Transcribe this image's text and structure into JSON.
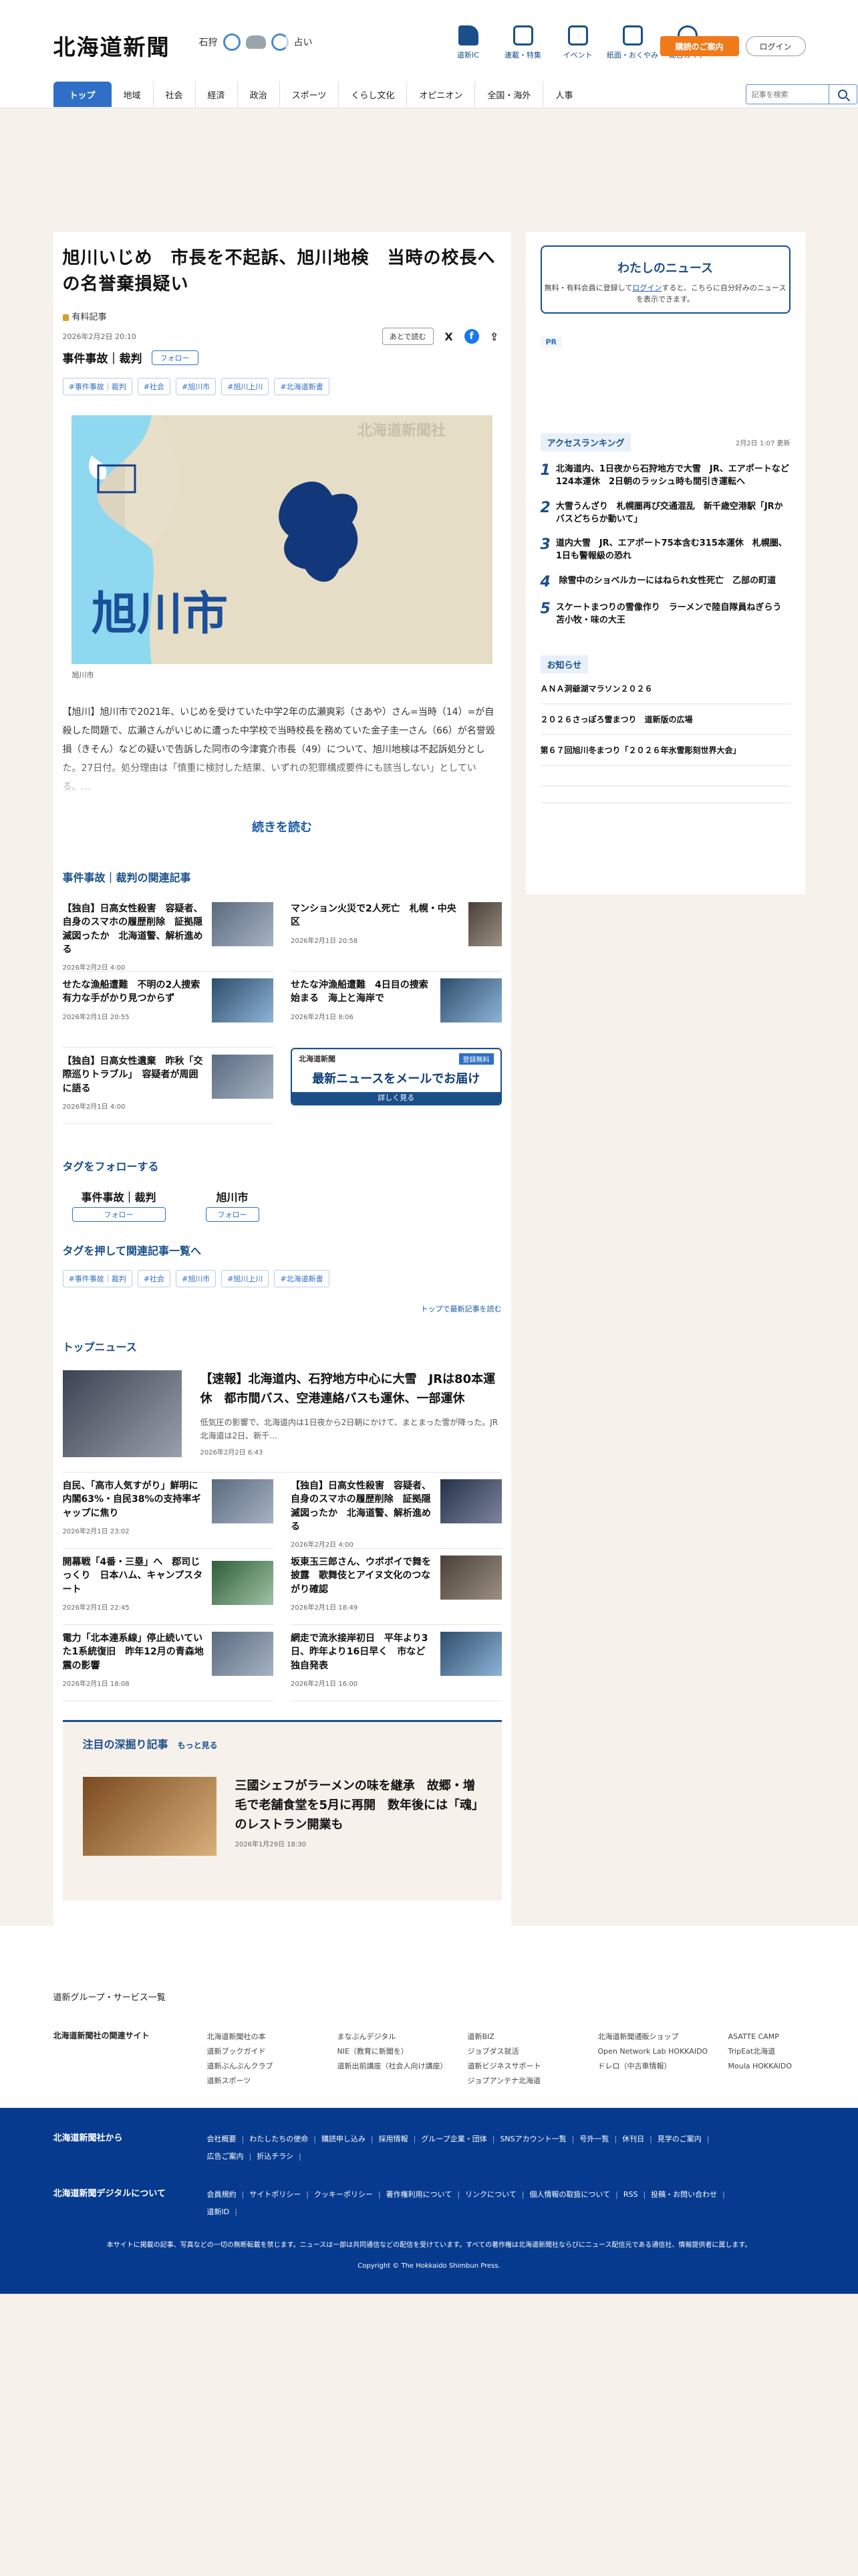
{
  "header": {
    "logo": "北海道新聞",
    "area": "石狩",
    "weather_label": "占い",
    "nav": [
      {
        "label": "道新IC",
        "icon": "building-icon"
      },
      {
        "label": "連載・特集",
        "icon": "flag-icon"
      },
      {
        "label": "イベント",
        "icon": "calendar-icon"
      },
      {
        "label": "紙面・おくやみ",
        "icon": "newspaper-icon"
      },
      {
        "label": "総合ガイド",
        "icon": "help-icon"
      }
    ],
    "subscribe": "購読のご案内",
    "login": "ログイン",
    "tabs": [
      "トップ",
      "地域",
      "社会",
      "経済",
      "政治",
      "スポーツ",
      "くらし文化",
      "オピニオン",
      "全国・海外",
      "人事"
    ],
    "search_placeholder": "記事を検索"
  },
  "article": {
    "title": "旭川いじめ　市長を不起訴、旭川地検　当時の校長への名誉棄損疑い",
    "author": "有料記事",
    "date": "2026年2月2日 20:10",
    "later": "あとで読む",
    "category": "事件事故｜裁判",
    "follow": "フォロー",
    "tags": [
      "#事件事故｜裁判",
      "#社会",
      "#旭川市",
      "#旭川上川",
      "#北海道新書"
    ],
    "map_watermark": "北海道新聞社",
    "map_label": "旭川市",
    "caption": "旭川市",
    "body": "【旭川】旭川市で2021年、いじめを受けていた中学2年の広瀬爽彩（さあや）さん=当時（14）=が自殺した問題で、広瀬さんがいじめに遭った中学校で当時校長を務めていた金子圭一さん（66）が名誉毀損（きそん）などの疑いで告訴した同市の今津寛介市長（49）について、旭川地検は不起訴処分とした。27日付。処分理由は「慎重に検討した結果、いずれの犯罪構成要件にも該当しない」としている。…",
    "more": "続きを読む"
  },
  "related": {
    "heading": "事件事故｜裁判の関連記事",
    "items": [
      {
        "title": "【独自】日高女性殺害　容疑者、自身のスマホの履歴削除　証拠隠滅図ったか　北海道警、解析進める",
        "date": "2026年2月2日 4:00"
      },
      {
        "title": "マンション火災で2人死亡　札幌・中央区",
        "date": "2026年2月1日 20:58"
      },
      {
        "title": "せたな漁船遭難　不明の2人捜索　有力な手がかり見つからず",
        "date": "2026年2月1日 20:55"
      },
      {
        "title": "せたな沖漁船遭難　4日目の捜索始まる　海上と海岸で",
        "date": "2026年2月1日 8:06"
      },
      {
        "title": "【独自】日高女性遺棄　昨秋「交際巡りトラブル」　容疑者が周囲に語る",
        "date": "2026年2月1日 4:00"
      }
    ],
    "ad": {
      "logo": "北海道新聞",
      "free": "登録無料",
      "headline": "最新ニュースをメールでお届け",
      "sub": "詳しく見る"
    }
  },
  "follow_tags": {
    "heading": "タグをフォローする",
    "items": [
      "事件事故｜裁判",
      "旭川市"
    ],
    "button": "フォロー"
  },
  "tag_search": {
    "heading": "タグを押して関連記事一覧へ",
    "tags": [
      "#事件事故｜裁判",
      "#社会",
      "#旭川市",
      "#旭川上川",
      "#北海道新書"
    ],
    "link": "トップで最新記事を読む"
  },
  "top_news": {
    "heading": "トップニュース",
    "lead": {
      "title": "【速報】北海道内、石狩地方中心に大雪　JRは80本運休　都市間バス、空港連絡バスも運休、一部運休",
      "excerpt": "低気圧の影響で、北海道内は1日夜から2日朝にかけて、まとまった雪が降った。JR北海道は2日、新千…",
      "date": "2026年2月2日 6:43"
    },
    "items": [
      {
        "title": "自民、「高市人気すがり」鮮明に　内閣63%・自民38%の支持率ギャップに焦り",
        "date": "2026年2月1日 23:02"
      },
      {
        "title": "【独自】日高女性殺害　容疑者、自身のスマホの履歴削除　証拠隠滅図ったか　北海道警、解析進める",
        "date": "2026年2月2日 4:00"
      },
      {
        "title": "開幕戦「4番・三塁」へ　郡司じっくり　日本ハム、キャンプスタート",
        "date": "2026年2月1日 22:45"
      },
      {
        "title": "坂東玉三郎さん、ウポポイで舞を披露　歌舞伎とアイヌ文化のつながり確認",
        "date": "2026年2月1日 18:49"
      },
      {
        "title": "電力「北本連系線」停止続いていた1系統復旧　昨年12月の青森地震の影響",
        "date": "2026年2月1日 18:08"
      },
      {
        "title": "網走で流氷接岸初日　平年より3日、昨年より16日早く　市など独自発表",
        "date": "2026年2月1日 16:00"
      }
    ]
  },
  "deep": {
    "heading": "注目の深掘り記事",
    "more": "もっと見る",
    "title": "三國シェフがラーメンの味を継承　故郷・増毛で老舗食堂を5月に再開　数年後には「魂」のレストラン開業も",
    "date": "2026年1月29日 18:30"
  },
  "side": {
    "my_title": "わたしのニュース",
    "my_text1": "無料・有料会員に登録して",
    "my_link": "ログイン",
    "my_text2": "すると、こちらに自分好みのニュースを表示できます。",
    "pr": "PR",
    "ranking_heading": "アクセスランキング",
    "ranking_updated": "2月2日 1:07 更新",
    "ranking": [
      "北海道内、1日夜から石狩地方で大雪　JR、エアポートなど124本運休　2日朝のラッシュ時も間引き運転へ",
      "大雪うんざり　札幌圏再び交通混乱　新千歳空港駅「JRかバスどちらか動いて」",
      "道内大雪　JR、エアポート75本含む315本運休　札幌圏、1日も警報級の恐れ",
      "除雪中のショベルカーにはねられ女性死亡　乙部の町道",
      "スケートまつりの雪像作り　ラーメンで陸自隊員ねぎらう　苫小牧・味の大王"
    ],
    "news_heading": "お知らせ",
    "news": [
      "ＡＮＡ洞爺湖マラソン２０２６",
      "２０２６さっぽろ雪まつり　道新版の広場",
      "第６７回旭川冬まつり「２０２６年氷雪彫刻世界大会」"
    ]
  },
  "footer": {
    "group": "道新グループ・サービス一覧",
    "sites_heading": "北海道新聞社の関連サイト",
    "sites": [
      [
        "北海道新聞社の本",
        "道新ブックガイド",
        "道新ぶんぶんクラブ",
        "道新スポーツ"
      ],
      [
        "まなぶんデジタル",
        "NIE（教育に新聞を）",
        "道新出前講座（社会人向け講座）"
      ],
      [
        "道新BIZ",
        "ジョブダス就活",
        "道新ビジネスサポート",
        "ジョブアンテナ北海道"
      ],
      [
        "北海道新聞通販ショップ",
        "Open Network Lab HOKKAIDO",
        "ドレロ（中古車情報）"
      ],
      [
        "ASATTE CAMP",
        "TripEat北海道",
        "Moula HOKKAIDO"
      ]
    ],
    "co_heading": "北海道新聞社から",
    "co_links": [
      "会社概要",
      "わたしたちの使命",
      "購読申し込み",
      "採用情報",
      "グループ企業・団体",
      "SNSアカウント一覧",
      "号外一覧",
      "休刊日",
      "見学のご案内",
      "広告ご案内",
      "折込チラシ"
    ],
    "dg_heading": "北海道新聞デジタルについて",
    "dg_links": [
      "会員規約",
      "サイトポリシー",
      "クッキーポリシー",
      "著作権利用について",
      "リンクについて",
      "個人情報の取扱について",
      "RSS",
      "投稿・お問い合わせ",
      "道新ID"
    ],
    "note": "本サイトに掲載の記事、写真などの一切の無断転載を禁じます。ニュースは一部は共同通信などの配信を受けています。すべての著作権は北海道新聞社ならびにニュース配信元である通信社、情報提供者に属します。",
    "copyright": "Copyright © The Hokkaido Shimbun Press."
  }
}
